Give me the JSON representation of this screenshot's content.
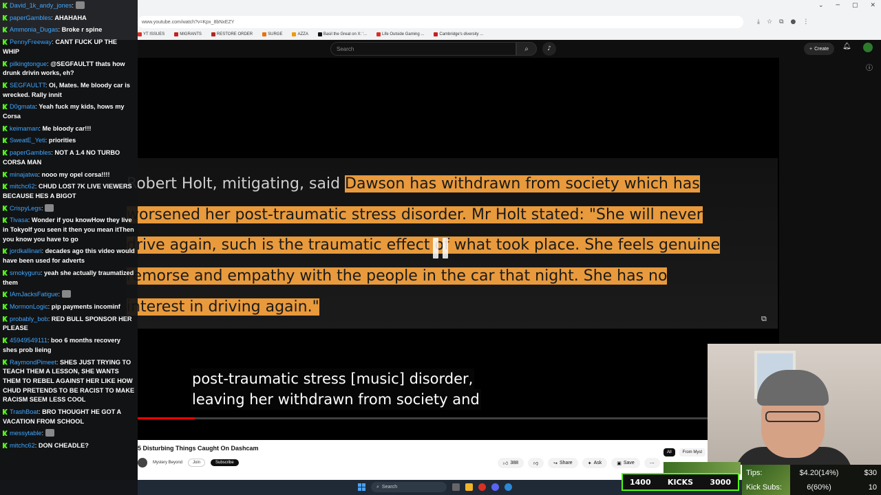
{
  "browser": {
    "url": "www.youtube.com/watch?v=Kpx_8bNxEZY",
    "bookmarks": [
      "YT ISSUES",
      "MIGRANTS",
      "RESTORE ORDER",
      "SURGE",
      "AZZA",
      "Basil the Great on X: '...",
      "Life Outside Gaming ...",
      "Cambridge's diversity ..."
    ]
  },
  "youtube": {
    "search_placeholder": "Search",
    "create_label": "Create",
    "video_title": "5 Disturbing Things Caught On Dashcam",
    "channel_name": "Mystery Beyond",
    "join_label": "Join",
    "subscribe_label": "Subscribe",
    "likes": "388",
    "share_label": "Share",
    "ask_label": "Ask",
    "save_label": "Save",
    "filter_all": "All",
    "filter_from": "From Myst",
    "captions": [
      "post-traumatic stress [music] disorder,",
      "leaving her withdrawn from society and"
    ],
    "progress": 0.1
  },
  "document_lines": [
    {
      "plain": "Robert Holt, mitigating, said ",
      "highlight": "Dawson has withdrawn from society which has"
    },
    {
      "plain": "",
      "highlight": "worsened her post-traumatic stress disorder. Mr Holt stated: \"She will never"
    },
    {
      "plain": "",
      "highlight": "drive again, such is the traumatic effect of what took place. She feels genuine"
    },
    {
      "plain": "",
      "highlight": "remorse and empathy with the people in the car that night. She has no"
    },
    {
      "plain": "",
      "highlight": "interest in driving again.\""
    }
  ],
  "chat": [
    {
      "user": "David_1k_andy_jones",
      "text": ""
    },
    {
      "user": "paperGambles",
      "text": "AHAHAHA"
    },
    {
      "user": "Ammonia_Dugas",
      "text": "Broke r spine"
    },
    {
      "user": "PennyFreeway",
      "text": "CANT FUCK UP THE WHIP"
    },
    {
      "user": "pilkingtongue",
      "text": "@SEGFAULTT thats how drunk drivin works, eh?"
    },
    {
      "user": "SEGFAULTT",
      "text": "Oi, Mates. Me bloody car is wrecked. Rally innit"
    },
    {
      "user": "D0gmata",
      "text": "Yeah fuck my kids, hows my Corsa"
    },
    {
      "user": "keimaman",
      "text": "Me bloody car!!!"
    },
    {
      "user": "SweatE_Yeti",
      "text": "priorities"
    },
    {
      "user": "paperGambles",
      "text": "NOT A 1.4 NO TURBO CORSA MAN"
    },
    {
      "user": "minajatwa",
      "text": "nooo my opel corsa!!!!"
    },
    {
      "user": "mitchc62",
      "text": "CHUD LOST 7K LIVE VIEWERS BECAUSE HES A BIGOT"
    },
    {
      "user": "CrispyLegs",
      "text": ""
    },
    {
      "user": "Tivasa",
      "text": "Wonder if you knowHow they live in TokyoIf you seen it then you mean itThen you know you have to go"
    },
    {
      "user": "jordkallinari",
      "text": "decades ago this video would have been used for adverts"
    },
    {
      "user": "smokyguru",
      "text": "yeah she actually traumatized them"
    },
    {
      "user": "IAmJacksFatigue",
      "text": ""
    },
    {
      "user": "MormonLogic",
      "text": "pip payments incominf"
    },
    {
      "user": "probably_bob",
      "text": "RED BULL SPONSOR HER PLEASE"
    },
    {
      "user": "45949549111",
      "text": "boo 6 months recovery shes prob lieing"
    },
    {
      "user": "RaymondPimeet",
      "text": "SHES JUST TRYING TO TEACH THEM A LESSON, SHE WANTS THEM TO REBEL AGAINST HER LIKE HOW CHUD PRETENDS TO BE RACIST TO MAKE RACISM SEEM LESS COOL"
    },
    {
      "user": "TrashBoat",
      "text": "BRO THOUGHT HE GOT A VACATION FROM SCHOOL"
    },
    {
      "user": "messytable",
      "text": ""
    },
    {
      "user": "mitchc62",
      "text": "DON CHEADLE?"
    }
  ],
  "stream": {
    "kicks_left": "1400",
    "kicks_label": "KICKS",
    "kicks_right": "3000",
    "tips_label": "Tips:",
    "tips_value": "$4.20(14%)",
    "tips_goal": "$30",
    "subs_label": "Kick Subs:",
    "subs_value": "6(60%)",
    "subs_goal": "10"
  },
  "taskbar": {
    "search_placeholder": "Search"
  }
}
